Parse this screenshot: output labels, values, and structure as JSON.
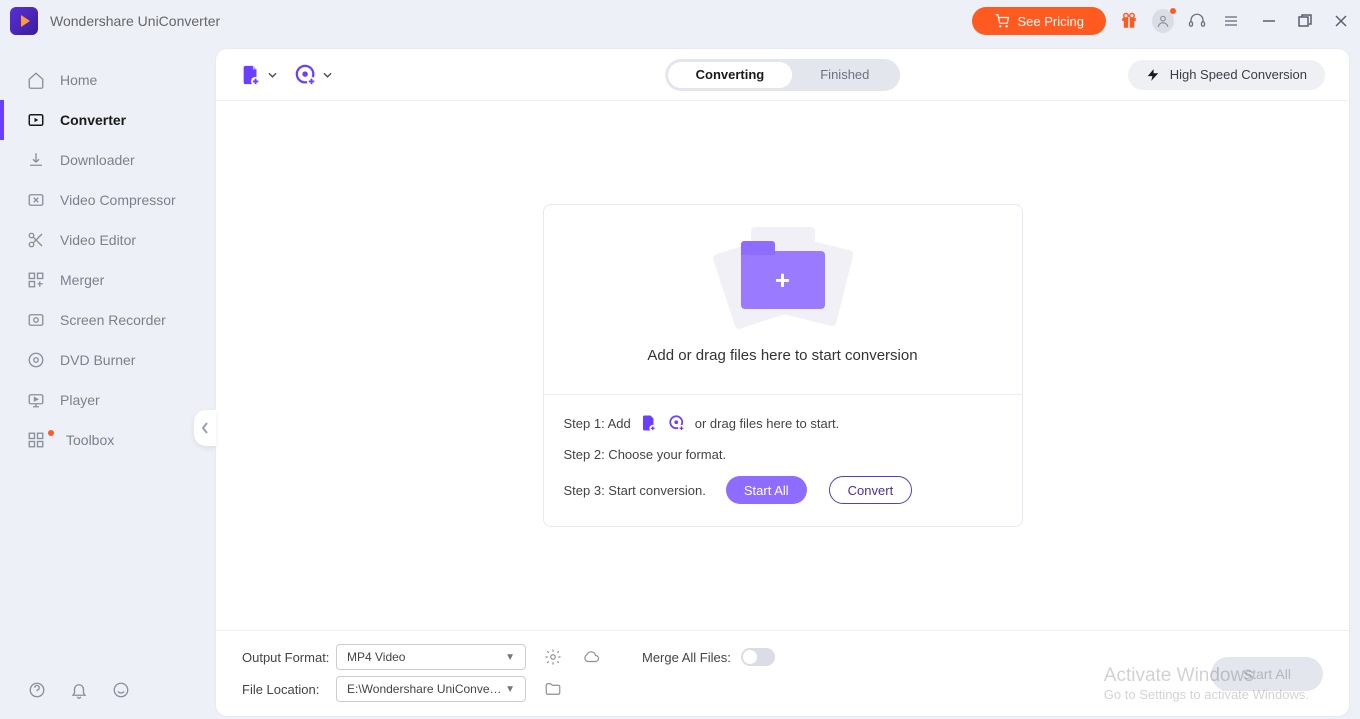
{
  "app": {
    "title": "Wondershare UniConverter"
  },
  "titlebar": {
    "pricing": "See Pricing"
  },
  "sidebar": {
    "items": [
      {
        "label": "Home"
      },
      {
        "label": "Converter"
      },
      {
        "label": "Downloader"
      },
      {
        "label": "Video Compressor"
      },
      {
        "label": "Video Editor"
      },
      {
        "label": "Merger"
      },
      {
        "label": "Screen Recorder"
      },
      {
        "label": "DVD Burner"
      },
      {
        "label": "Player"
      },
      {
        "label": "Toolbox"
      }
    ]
  },
  "tabs": {
    "converting": "Converting",
    "finished": "Finished"
  },
  "hsc": {
    "label": "High Speed Conversion"
  },
  "drop": {
    "msg": "Add or drag files here to start conversion",
    "step1a": "Step 1: Add",
    "step1b": "or drag files here to start.",
    "step2": "Step 2: Choose your format.",
    "step3": "Step 3: Start conversion.",
    "start_all": "Start All",
    "convert": "Convert"
  },
  "bottom": {
    "output_label": "Output Format:",
    "output_value": "MP4 Video",
    "location_label": "File Location:",
    "location_value": "E:\\Wondershare UniConverter",
    "merge_label": "Merge All Files:",
    "start_all": "Start All"
  },
  "watermark": {
    "t1": "Activate Windows",
    "t2": "Go to Settings to activate Windows."
  }
}
